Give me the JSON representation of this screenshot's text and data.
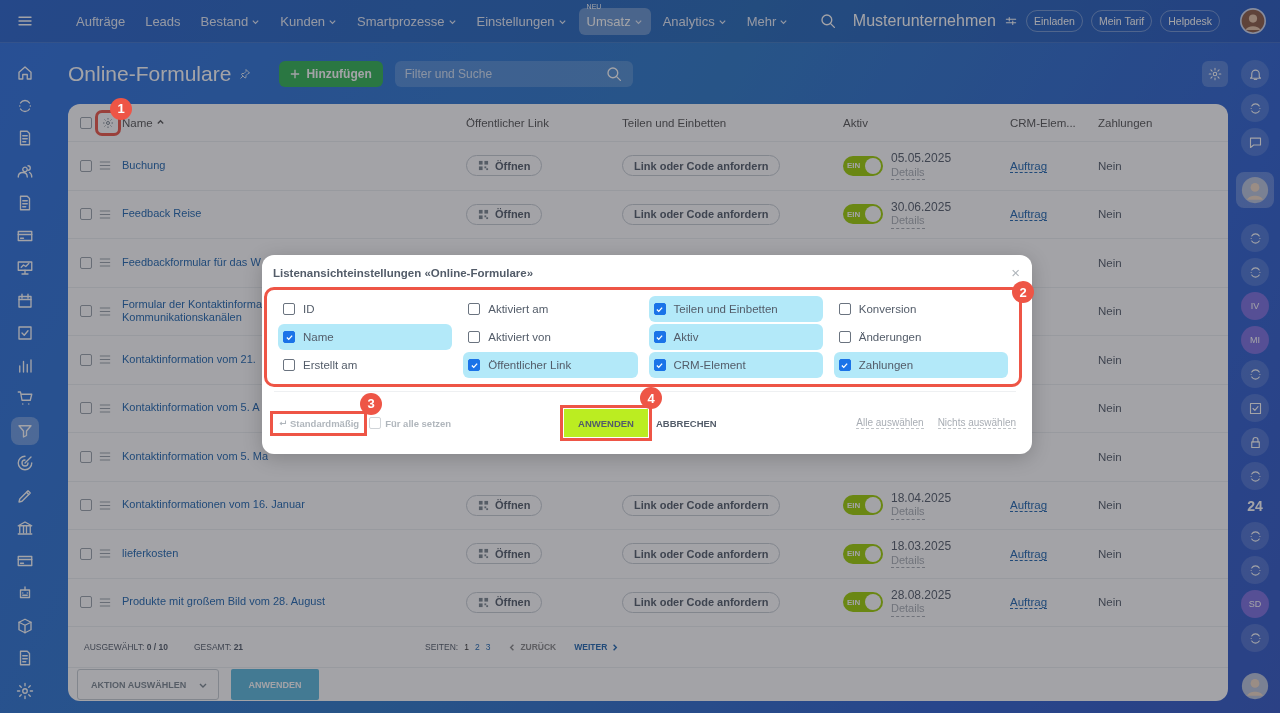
{
  "top_nav": {
    "items": [
      {
        "label": "Aufträge",
        "dropdown": false,
        "selected": false
      },
      {
        "label": "Leads",
        "dropdown": false,
        "selected": false
      },
      {
        "label": "Bestand",
        "dropdown": true,
        "selected": false
      },
      {
        "label": "Kunden",
        "dropdown": true,
        "selected": false
      },
      {
        "label": "Smartprozesse",
        "dropdown": true,
        "selected": false
      },
      {
        "label": "Einstellungen",
        "dropdown": true,
        "selected": false
      },
      {
        "label": "Umsatz",
        "dropdown": true,
        "selected": true,
        "badge": "NEU"
      },
      {
        "label": "Analytics",
        "dropdown": true,
        "selected": false
      },
      {
        "label": "Mehr",
        "dropdown": true,
        "selected": false
      }
    ],
    "company": "Musterunternehmen",
    "buttons": [
      "Einladen",
      "Mein Tarif",
      "Helpdesk"
    ]
  },
  "left_rail": [
    {
      "selected": false
    },
    {
      "selected": false
    },
    {
      "selected": false
    },
    {
      "selected": false
    },
    {
      "selected": false
    },
    {
      "selected": false
    },
    {
      "selected": false
    },
    {
      "selected": false
    },
    {
      "selected": false
    },
    {
      "selected": false
    },
    {
      "selected": false
    },
    {
      "selected": true
    },
    {
      "selected": false
    },
    {
      "selected": false
    },
    {
      "selected": false
    },
    {
      "selected": false
    },
    {
      "selected": false
    },
    {
      "selected": false
    },
    {
      "selected": false
    },
    {
      "selected": false
    }
  ],
  "right_rail": [
    {
      "kind": "icon"
    },
    {
      "kind": "icon"
    },
    {
      "kind": "icon"
    },
    {
      "kind": "avatar",
      "selected": true
    },
    {
      "kind": "icon"
    },
    {
      "kind": "icon"
    },
    {
      "kind": "initials",
      "text": "IV"
    },
    {
      "kind": "initials",
      "text": "MI"
    },
    {
      "kind": "icon"
    },
    {
      "kind": "icon"
    },
    {
      "kind": "icon"
    },
    {
      "kind": "icon"
    },
    {
      "kind": "counter",
      "text": "24"
    },
    {
      "kind": "icon"
    },
    {
      "kind": "icon"
    },
    {
      "kind": "initials",
      "text": "SD"
    },
    {
      "kind": "icon"
    },
    {
      "kind": "avatar",
      "selected": false
    }
  ],
  "page": {
    "title": "Online-Formulare",
    "add_button": "Hinzufügen",
    "search": {
      "placeholder": "Filter und Suche"
    }
  },
  "table": {
    "settings_callout": "1",
    "all_checked": false,
    "columns": [
      {
        "label": "Name",
        "sorted": true
      },
      {
        "label": "Öffentlicher Link",
        "sorted": false
      },
      {
        "label": "Teilen und Einbetten",
        "sorted": false
      },
      {
        "label": "Aktiv",
        "sorted": false
      },
      {
        "label": "CRM-Elem...",
        "sorted": false
      },
      {
        "label": "Zahlungen",
        "sorted": false
      }
    ],
    "rows": [
      {
        "checked": false,
        "name": "Buchung",
        "link": "Öffnen",
        "share": "Link oder Code anfordern",
        "active": {
          "on": true,
          "label": "EIN"
        },
        "date": "05.05.2025",
        "details": "Details",
        "crm": "Auftrag",
        "payments": "Nein"
      },
      {
        "checked": false,
        "name": "Feedback Reise",
        "link": "Öffnen",
        "share": "Link oder Code anfordern",
        "active": {
          "on": true,
          "label": "EIN"
        },
        "date": "30.06.2025",
        "details": "Details",
        "crm": "Auftrag",
        "payments": "Nein"
      },
      {
        "checked": false,
        "name": "Feedbackformular für das W",
        "payments": "Nein"
      },
      {
        "checked": false,
        "name": "Formular der Kontaktinforma\nKommunikationskanälen",
        "payments": "Nein"
      },
      {
        "checked": false,
        "name": "Kontaktinformation vom 21.",
        "payments": "Nein"
      },
      {
        "checked": false,
        "name": "Kontaktinformation vom 5. A",
        "payments": "Nein"
      },
      {
        "checked": false,
        "name": "Kontaktinformation vom 5. Ma",
        "payments": "Nein"
      },
      {
        "checked": false,
        "name": "Kontaktinformationen vom 16. Januar",
        "link": "Öffnen",
        "share": "Link oder Code anfordern",
        "active": {
          "on": true,
          "label": "EIN"
        },
        "date": "18.04.2025",
        "details": "Details",
        "crm": "Auftrag",
        "payments": "Nein"
      },
      {
        "checked": false,
        "name": "lieferkosten",
        "link": "Öffnen",
        "share": "Link oder Code anfordern",
        "active": {
          "on": true,
          "label": "EIN"
        },
        "date": "18.03.2025",
        "details": "Details",
        "crm": "Auftrag",
        "payments": "Nein"
      },
      {
        "checked": false,
        "name": "Produkte mit großem Bild vom 28. August",
        "link": "Öffnen",
        "share": "Link oder Code anfordern",
        "active": {
          "on": true,
          "label": "EIN"
        },
        "date": "28.08.2025",
        "details": "Details",
        "crm": "Auftrag",
        "payments": "Nein"
      }
    ],
    "footer": {
      "selected_label": "AUSGEWÄHLT:",
      "selected_value": "0 / 10",
      "total_label": "GESAMT:",
      "total_value": "21",
      "pages_label": "SEITEN:",
      "pages": [
        {
          "label": "1",
          "selected": true
        },
        {
          "label": "2",
          "selected": false
        },
        {
          "label": "3",
          "selected": false
        }
      ],
      "prev": {
        "label": "ZURÜCK",
        "disabled": true
      },
      "next": {
        "label": "WEITER",
        "disabled": false
      }
    },
    "actions": {
      "select": "AKTION AUSWÄHLEN",
      "apply": {
        "label": "ANWENDEN",
        "disabled": true
      }
    }
  },
  "dialog": {
    "title": "Listenansichteinstellungen «Online-Formulare»",
    "close": "×",
    "columns_callout": "2",
    "options": [
      {
        "label": "ID",
        "checked": false
      },
      {
        "label": "Aktiviert am",
        "checked": false
      },
      {
        "label": "Teilen und Einbetten",
        "checked": true
      },
      {
        "label": "Konversion",
        "checked": false
      },
      {
        "label": "Name",
        "checked": true
      },
      {
        "label": "Aktiviert von",
        "checked": false
      },
      {
        "label": "Aktiv",
        "checked": true
      },
      {
        "label": "Änderungen",
        "checked": false
      },
      {
        "label": "Erstellt am",
        "checked": false
      },
      {
        "label": "Öffentlicher Link",
        "checked": true
      },
      {
        "label": "CRM-Element",
        "checked": true
      },
      {
        "label": "Zahlungen",
        "checked": true
      }
    ],
    "reset": {
      "label": "Standardmäßig",
      "callout": "3"
    },
    "for_all": {
      "label": "Für alle setzen",
      "checked": false
    },
    "apply": {
      "label": "ANWENDEN",
      "callout": "4"
    },
    "cancel": "ABBRECHEN",
    "select_all": "Alle auswählen",
    "select_none": "Nichts auswählen"
  }
}
